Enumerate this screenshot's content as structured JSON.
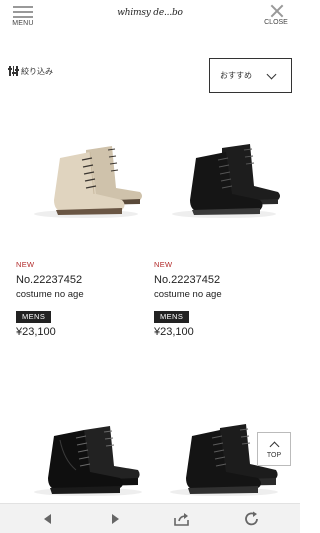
{
  "header": {
    "menu_label": "MENU",
    "logo_text": "whimsy de...bo",
    "close_label": "CLOSE"
  },
  "filter": {
    "label": "絞り込み"
  },
  "sort": {
    "selected": "おすすめ"
  },
  "products": [
    {
      "badge": "NEW",
      "code": "No.22237452",
      "brand": "costume no age",
      "category": "MENS",
      "price": "¥23,100",
      "color": "beige suede"
    },
    {
      "badge": "NEW",
      "code": "No.22237452",
      "brand": "costume no age",
      "category": "MENS",
      "price": "¥23,100",
      "color": "black suede"
    },
    {
      "color": "black leather"
    },
    {
      "color": "black suede"
    }
  ],
  "top_button": {
    "label": "TOP"
  },
  "toolbar": {
    "icons": [
      "back-arrow-icon",
      "forward-arrow-icon",
      "share-icon",
      "reload-icon"
    ]
  },
  "colors": {
    "new_badge": "#b22a2a",
    "category_bg": "#222222",
    "toolbar_bg": "#f2f2f2"
  }
}
